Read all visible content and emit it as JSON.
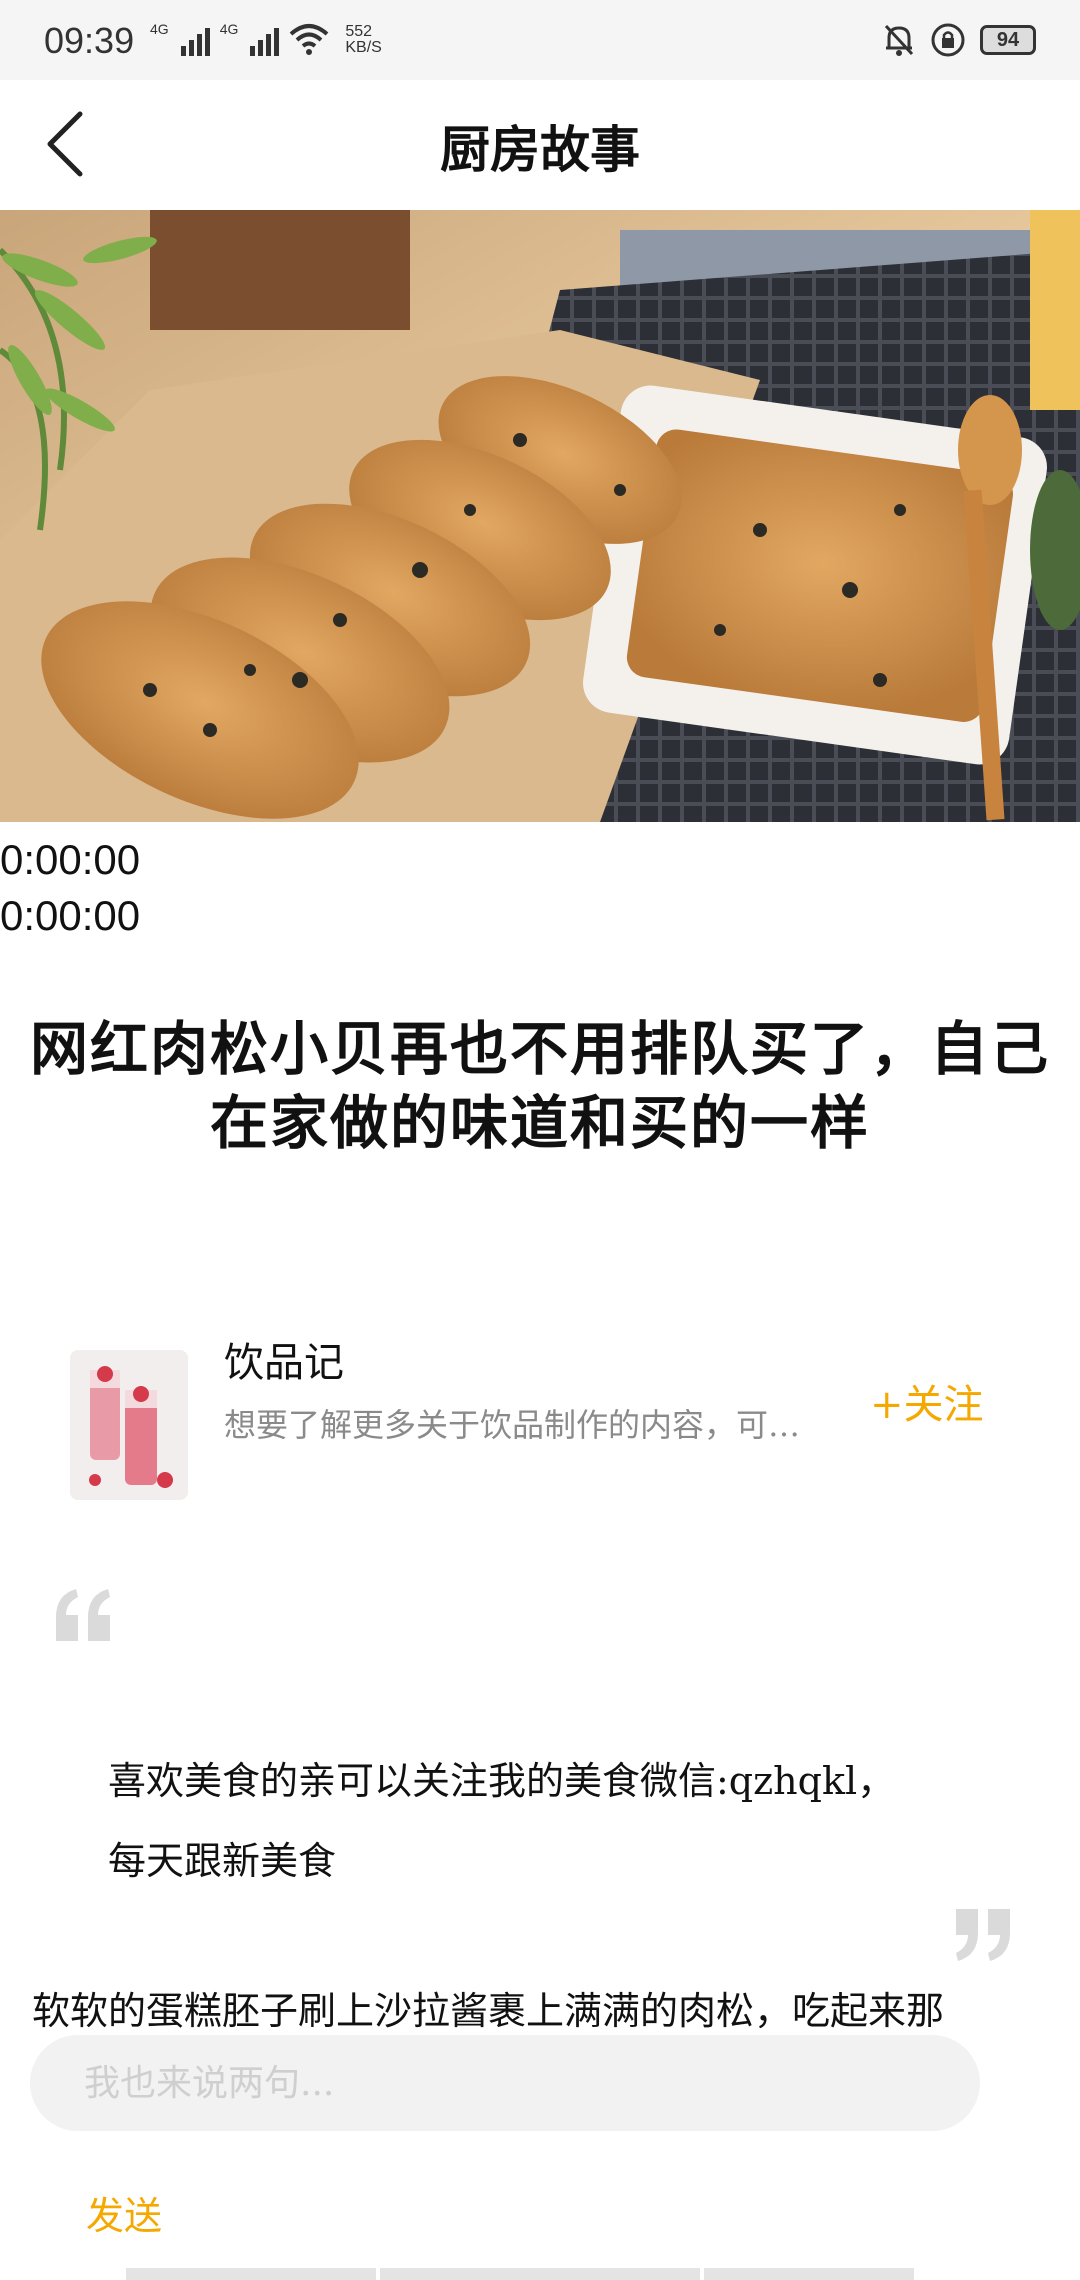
{
  "status_bar": {
    "time": "09:39",
    "signal_1_label": "4G",
    "signal_2_label": "4G",
    "net_speed_value": "552",
    "net_speed_unit": "KB/S",
    "battery": "94",
    "icons": [
      "signal-icon",
      "wifi-icon",
      "mute-bell-icon",
      "lock-rotation-icon",
      "battery-icon"
    ]
  },
  "header": {
    "title": "厨房故事",
    "back_icon": "back-arrow-icon"
  },
  "player": {
    "current_time": "0:00:00",
    "duration": "0:00:00"
  },
  "article": {
    "title_line1": "网红肉松小贝再也不用排队买了，自己",
    "title_line2": "在家做的味道和买的一样"
  },
  "author": {
    "name": "饮品记",
    "description": "想要了解更多关于饮品制作的内容，可…",
    "follow_label": "+关注"
  },
  "quote": {
    "line1": "喜欢美食的亲可以关注我的美食微信:qzhqkl，",
    "line2": "每天跟新美食"
  },
  "body": {
    "paragraph": "软软的蛋糕胚子刷上沙拉酱裹上满满的肉松，吃起来那"
  },
  "comment": {
    "placeholder": "我也来说两句...",
    "value": "",
    "send_label": "发送"
  },
  "colors": {
    "accent": "#f5a800",
    "muted_text": "#8a8a8a",
    "input_bg": "#f2f2f2"
  }
}
